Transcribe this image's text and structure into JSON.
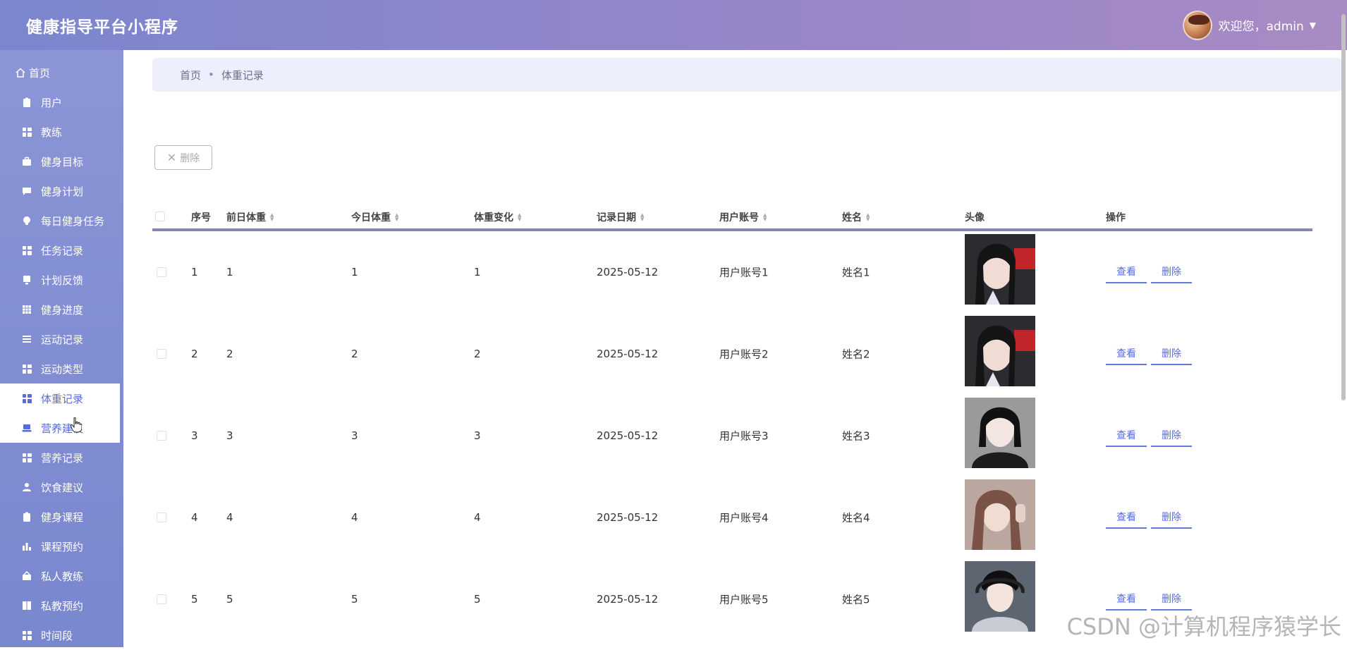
{
  "header": {
    "title": "健康指导平台小程序",
    "welcome": "欢迎您，admin"
  },
  "sidebar": {
    "items": [
      {
        "label": "首页",
        "icon": "home-icon"
      },
      {
        "label": "用户",
        "icon": "clipboard-icon"
      },
      {
        "label": "教练",
        "icon": "grid-icon"
      },
      {
        "label": "健身目标",
        "icon": "briefcase-icon"
      },
      {
        "label": "健身计划",
        "icon": "chat-icon"
      },
      {
        "label": "每日健身任务",
        "icon": "bulb-icon"
      },
      {
        "label": "任务记录",
        "icon": "grid-icon"
      },
      {
        "label": "计划反馈",
        "icon": "monitor-icon"
      },
      {
        "label": "健身进度",
        "icon": "table-icon"
      },
      {
        "label": "运动记录",
        "icon": "list-icon"
      },
      {
        "label": "运动类型",
        "icon": "grid-icon"
      },
      {
        "label": "体重记录",
        "icon": "grid-icon"
      },
      {
        "label": "营养建议",
        "icon": "laptop-icon"
      },
      {
        "label": "营养记录",
        "icon": "grid-icon"
      },
      {
        "label": "饮食建议",
        "icon": "user-icon"
      },
      {
        "label": "健身课程",
        "icon": "clipboard-icon"
      },
      {
        "label": "课程预约",
        "icon": "bar-chart-icon"
      },
      {
        "label": "私人教练",
        "icon": "money-icon"
      },
      {
        "label": "私教预约",
        "icon": "book-icon"
      },
      {
        "label": "时间段",
        "icon": "grid-icon"
      }
    ],
    "active_index": 11
  },
  "breadcrumb": {
    "home": "首页",
    "sep": "•",
    "current": "体重记录"
  },
  "toolbar": {
    "delete_label": "删除"
  },
  "table": {
    "headers": {
      "index": "序号",
      "prev_weight": "前日体重",
      "today_weight": "今日体重",
      "change": "体重变化",
      "date": "记录日期",
      "account": "用户账号",
      "name": "姓名",
      "avatar": "头像",
      "ops": "操作"
    },
    "rows": [
      {
        "index": "1",
        "prev": "1",
        "today": "1",
        "change": "1",
        "date": "2025-05-12",
        "account": "用户账号1",
        "name": "姓名1"
      },
      {
        "index": "2",
        "prev": "2",
        "today": "2",
        "change": "2",
        "date": "2025-05-12",
        "account": "用户账号2",
        "name": "姓名2"
      },
      {
        "index": "3",
        "prev": "3",
        "today": "3",
        "change": "3",
        "date": "2025-05-12",
        "account": "用户账号3",
        "name": "姓名3"
      },
      {
        "index": "4",
        "prev": "4",
        "today": "4",
        "change": "4",
        "date": "2025-05-12",
        "account": "用户账号4",
        "name": "姓名4"
      },
      {
        "index": "5",
        "prev": "5",
        "today": "5",
        "change": "5",
        "date": "2025-05-12",
        "account": "用户账号5",
        "name": "姓名5"
      }
    ],
    "view_label": "查看",
    "delete_label": "删除"
  },
  "watermark": "CSDN @计算机程序猿学长",
  "colors": {
    "accent": "#5a6bd6",
    "sidebar": "#8b95d6",
    "header_start": "#7b86cf",
    "header_end": "#a78bc4"
  }
}
